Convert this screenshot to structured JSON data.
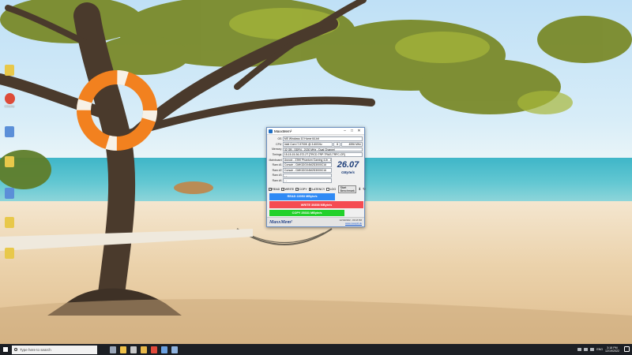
{
  "desktop": {
    "icons": [
      {
        "label": "",
        "color": "#e8c84a"
      },
      {
        "label": "",
        "color": "#e8c84a"
      },
      {
        "label": "Chrome",
        "color": "#dd4b39"
      },
      {
        "label": "",
        "color": "#5b8fd8"
      },
      {
        "label": "",
        "color": "#e8c84a"
      },
      {
        "label": "",
        "color": "#5b8fd8"
      },
      {
        "label": "",
        "color": "#e8c84a"
      },
      {
        "label": "",
        "color": "#e8c84a"
      }
    ]
  },
  "window": {
    "title": "MaxxMem²",
    "controls": {
      "minimize": "–",
      "maximize": "□",
      "close": "✕"
    },
    "info": [
      {
        "label": "OS",
        "value": "MS Windows 10 Home 64-bit"
      },
      {
        "label": "CPU",
        "value": "Intel Core i7-9700K @ 3.60GHz"
      },
      {
        "label": "Memory",
        "value": "32 GB - DDR4 - 2130 MHz - Dual Channel"
      },
      {
        "label": "Timings",
        "value": "15-15-15-36-372-2T [TRCD-TRP-TRAS-TRFC-CR]"
      },
      {
        "label": "Mainboard",
        "value": "Asrock - Z390 Phantom Gaming 4-ib - L4.10"
      },
      {
        "label": "Ram #1",
        "value": "Corsair - CMK32GX4M2D3000C16"
      },
      {
        "label": "Ram #2",
        "value": "Corsair - CMK32GX4M2D3000C16"
      },
      {
        "label": "Ram #3",
        "value": "- -"
      },
      {
        "label": "Ram #4",
        "value": "- -"
      }
    ],
    "cpu_multiplier": "8",
    "cpu_clock": "4596 MHz",
    "speed": {
      "value": "26.07",
      "unit": "GByte/s"
    },
    "checks": [
      {
        "label": "READ",
        "checked": true
      },
      {
        "label": "WRITE",
        "checked": true
      },
      {
        "label": "COPY",
        "checked": true
      },
      {
        "label": "LATENCY",
        "checked": true
      },
      {
        "label": "LOG",
        "checked": false
      }
    ],
    "start_label": "Start Benchmark",
    "bars": [
      {
        "key": "read",
        "label": "READ  22053  MByte/s",
        "fraction": 0.7
      },
      {
        "key": "write",
        "label": "WRITE  30858  MByte/s",
        "fraction": 1.0
      },
      {
        "key": "copy",
        "label": "COPY  25331  MByte/s",
        "fraction": 0.8
      },
      {
        "key": "lat",
        "label": "LATENCY  78.2  ns",
        "fraction": 0.48
      }
    ],
    "footer": {
      "logo": "MaxxMem²",
      "date": "12/19/2022 - 03:18 PM",
      "url": "www.maxxpi2.de"
    }
  },
  "taskbar": {
    "search_placeholder": "Type here to search",
    "apps": [
      {
        "name": "task-view",
        "color": "#9aa6b8"
      },
      {
        "name": "explorer",
        "color": "#f0c24a"
      },
      {
        "name": "settings",
        "color": "#c8c8c8"
      },
      {
        "name": "files",
        "color": "#e8b84a"
      },
      {
        "name": "chrome",
        "color": "#e04a3a"
      },
      {
        "name": "app",
        "color": "#6aa0e0"
      },
      {
        "name": "maxxmem",
        "color": "#8fb3df"
      }
    ],
    "lang": "ENG",
    "time": "3:18 PM",
    "date": "12/19/2022"
  }
}
